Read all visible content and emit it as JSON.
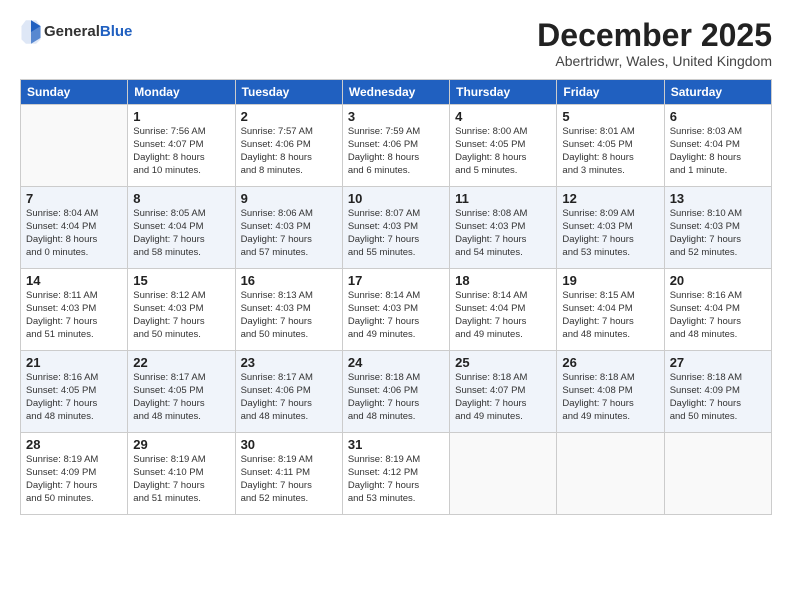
{
  "logo": {
    "general": "General",
    "blue": "Blue"
  },
  "title": "December 2025",
  "location": "Abertridwr, Wales, United Kingdom",
  "days_of_week": [
    "Sunday",
    "Monday",
    "Tuesday",
    "Wednesday",
    "Thursday",
    "Friday",
    "Saturday"
  ],
  "weeks": [
    [
      {
        "day": "",
        "info": ""
      },
      {
        "day": "1",
        "info": "Sunrise: 7:56 AM\nSunset: 4:07 PM\nDaylight: 8 hours\nand 10 minutes."
      },
      {
        "day": "2",
        "info": "Sunrise: 7:57 AM\nSunset: 4:06 PM\nDaylight: 8 hours\nand 8 minutes."
      },
      {
        "day": "3",
        "info": "Sunrise: 7:59 AM\nSunset: 4:06 PM\nDaylight: 8 hours\nand 6 minutes."
      },
      {
        "day": "4",
        "info": "Sunrise: 8:00 AM\nSunset: 4:05 PM\nDaylight: 8 hours\nand 5 minutes."
      },
      {
        "day": "5",
        "info": "Sunrise: 8:01 AM\nSunset: 4:05 PM\nDaylight: 8 hours\nand 3 minutes."
      },
      {
        "day": "6",
        "info": "Sunrise: 8:03 AM\nSunset: 4:04 PM\nDaylight: 8 hours\nand 1 minute."
      }
    ],
    [
      {
        "day": "7",
        "info": "Sunrise: 8:04 AM\nSunset: 4:04 PM\nDaylight: 8 hours\nand 0 minutes."
      },
      {
        "day": "8",
        "info": "Sunrise: 8:05 AM\nSunset: 4:04 PM\nDaylight: 7 hours\nand 58 minutes."
      },
      {
        "day": "9",
        "info": "Sunrise: 8:06 AM\nSunset: 4:03 PM\nDaylight: 7 hours\nand 57 minutes."
      },
      {
        "day": "10",
        "info": "Sunrise: 8:07 AM\nSunset: 4:03 PM\nDaylight: 7 hours\nand 55 minutes."
      },
      {
        "day": "11",
        "info": "Sunrise: 8:08 AM\nSunset: 4:03 PM\nDaylight: 7 hours\nand 54 minutes."
      },
      {
        "day": "12",
        "info": "Sunrise: 8:09 AM\nSunset: 4:03 PM\nDaylight: 7 hours\nand 53 minutes."
      },
      {
        "day": "13",
        "info": "Sunrise: 8:10 AM\nSunset: 4:03 PM\nDaylight: 7 hours\nand 52 minutes."
      }
    ],
    [
      {
        "day": "14",
        "info": "Sunrise: 8:11 AM\nSunset: 4:03 PM\nDaylight: 7 hours\nand 51 minutes."
      },
      {
        "day": "15",
        "info": "Sunrise: 8:12 AM\nSunset: 4:03 PM\nDaylight: 7 hours\nand 50 minutes."
      },
      {
        "day": "16",
        "info": "Sunrise: 8:13 AM\nSunset: 4:03 PM\nDaylight: 7 hours\nand 50 minutes."
      },
      {
        "day": "17",
        "info": "Sunrise: 8:14 AM\nSunset: 4:03 PM\nDaylight: 7 hours\nand 49 minutes."
      },
      {
        "day": "18",
        "info": "Sunrise: 8:14 AM\nSunset: 4:04 PM\nDaylight: 7 hours\nand 49 minutes."
      },
      {
        "day": "19",
        "info": "Sunrise: 8:15 AM\nSunset: 4:04 PM\nDaylight: 7 hours\nand 48 minutes."
      },
      {
        "day": "20",
        "info": "Sunrise: 8:16 AM\nSunset: 4:04 PM\nDaylight: 7 hours\nand 48 minutes."
      }
    ],
    [
      {
        "day": "21",
        "info": "Sunrise: 8:16 AM\nSunset: 4:05 PM\nDaylight: 7 hours\nand 48 minutes."
      },
      {
        "day": "22",
        "info": "Sunrise: 8:17 AM\nSunset: 4:05 PM\nDaylight: 7 hours\nand 48 minutes."
      },
      {
        "day": "23",
        "info": "Sunrise: 8:17 AM\nSunset: 4:06 PM\nDaylight: 7 hours\nand 48 minutes."
      },
      {
        "day": "24",
        "info": "Sunrise: 8:18 AM\nSunset: 4:06 PM\nDaylight: 7 hours\nand 48 minutes."
      },
      {
        "day": "25",
        "info": "Sunrise: 8:18 AM\nSunset: 4:07 PM\nDaylight: 7 hours\nand 49 minutes."
      },
      {
        "day": "26",
        "info": "Sunrise: 8:18 AM\nSunset: 4:08 PM\nDaylight: 7 hours\nand 49 minutes."
      },
      {
        "day": "27",
        "info": "Sunrise: 8:18 AM\nSunset: 4:09 PM\nDaylight: 7 hours\nand 50 minutes."
      }
    ],
    [
      {
        "day": "28",
        "info": "Sunrise: 8:19 AM\nSunset: 4:09 PM\nDaylight: 7 hours\nand 50 minutes."
      },
      {
        "day": "29",
        "info": "Sunrise: 8:19 AM\nSunset: 4:10 PM\nDaylight: 7 hours\nand 51 minutes."
      },
      {
        "day": "30",
        "info": "Sunrise: 8:19 AM\nSunset: 4:11 PM\nDaylight: 7 hours\nand 52 minutes."
      },
      {
        "day": "31",
        "info": "Sunrise: 8:19 AM\nSunset: 4:12 PM\nDaylight: 7 hours\nand 53 minutes."
      },
      {
        "day": "",
        "info": ""
      },
      {
        "day": "",
        "info": ""
      },
      {
        "day": "",
        "info": ""
      }
    ]
  ]
}
